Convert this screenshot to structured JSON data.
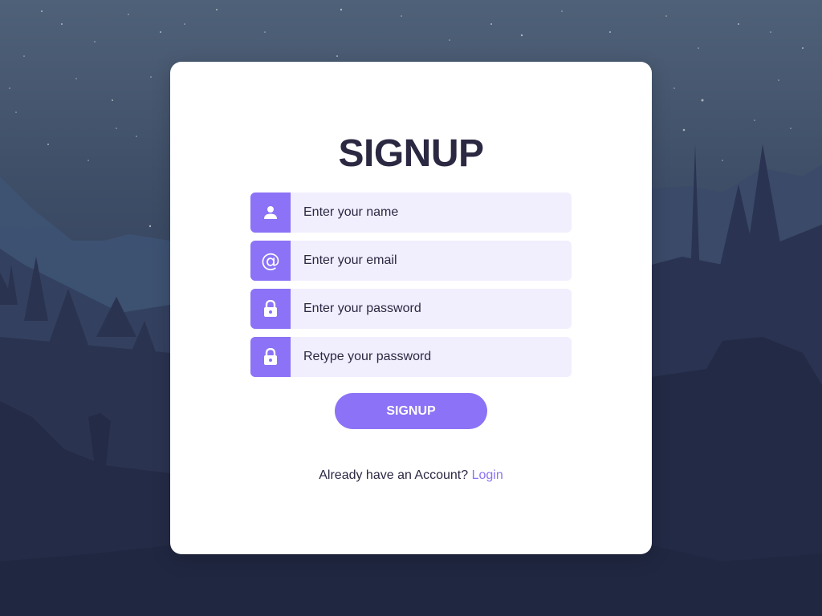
{
  "background": {
    "sky_color": "#4f6178",
    "mountain_color": "#2f3a58",
    "forest_color": "#232a44"
  },
  "signup_card": {
    "title": "SIGNUP",
    "fields": [
      {
        "icon": "user-icon",
        "placeholder": "Enter your name",
        "type": "text"
      },
      {
        "icon": "at-icon",
        "placeholder": "Enter your email",
        "type": "email"
      },
      {
        "icon": "lock-icon",
        "placeholder": "Enter your password",
        "type": "password"
      },
      {
        "icon": "lock-icon",
        "placeholder": "Retype your password",
        "type": "password"
      }
    ],
    "submit_label": "SIGNUP",
    "footer_text": "Already have an Account?",
    "login_label": "Login"
  },
  "colors": {
    "accent": "#8b72f6",
    "field_background": "#f1effe",
    "title_text": "#2b2842",
    "card_background": "#ffffff"
  }
}
